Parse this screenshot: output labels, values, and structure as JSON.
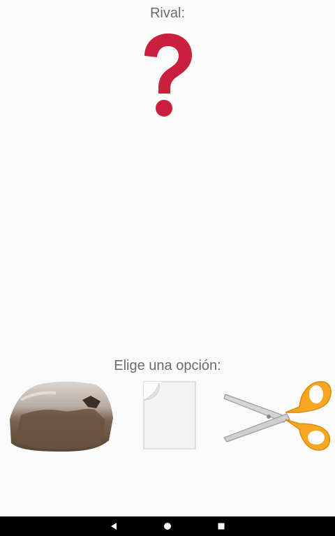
{
  "rival": {
    "label": "Rival:",
    "choice_icon": "question-mark-icon",
    "choice_color": "#c8203d"
  },
  "player": {
    "prompt": "Elige una opción:",
    "options": [
      {
        "id": "rock",
        "icon": "rock-icon"
      },
      {
        "id": "paper",
        "icon": "paper-icon"
      },
      {
        "id": "scissors",
        "icon": "scissors-icon"
      }
    ]
  },
  "navbar": {
    "buttons": [
      "back-icon",
      "home-icon",
      "recents-icon"
    ]
  }
}
